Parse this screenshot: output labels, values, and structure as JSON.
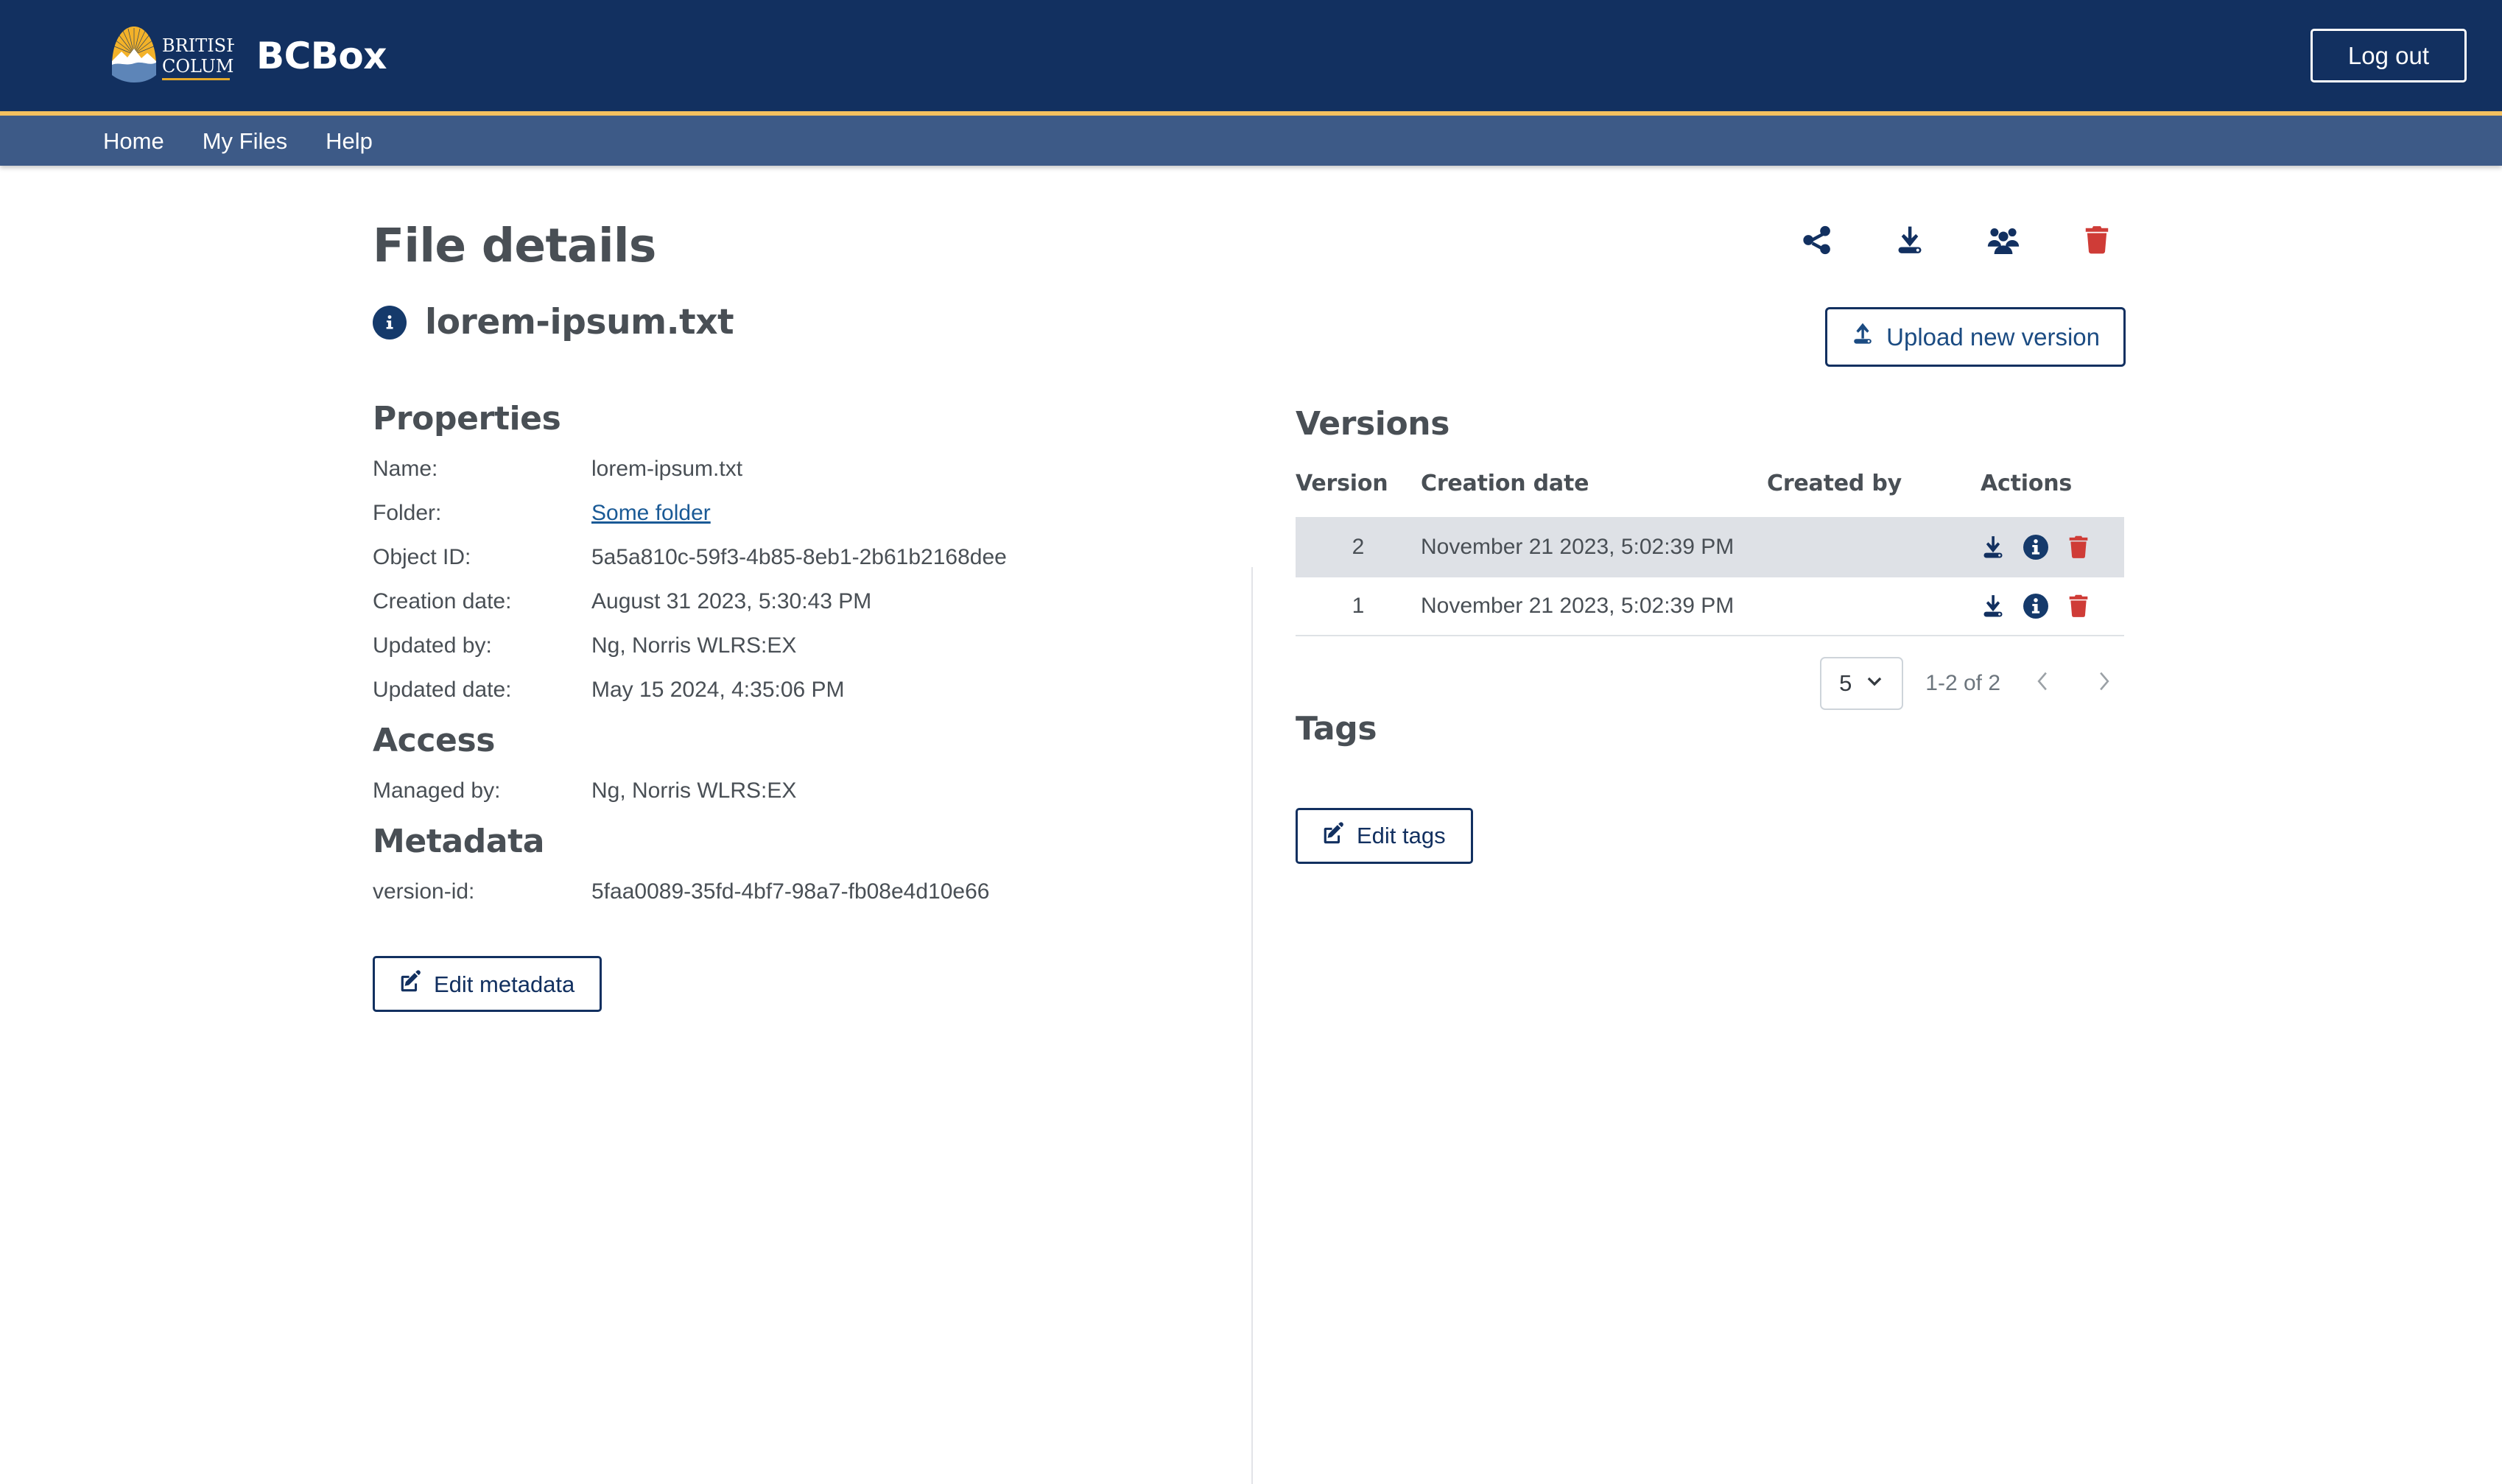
{
  "header": {
    "logo_name": "bc-government-logo",
    "logo_line1": "BRITISH",
    "logo_line2": "COLUMBIA",
    "app_title": "BCBox",
    "logout_label": "Log out",
    "brand_navy": "#123060",
    "brand_gold": "#f3c05f",
    "nav_blue": "#3d5a87"
  },
  "nav": {
    "items": [
      {
        "label": "Home"
      },
      {
        "label": "My Files"
      },
      {
        "label": "Help"
      }
    ]
  },
  "main": {
    "page_title": "File details",
    "file_name": "lorem-ipsum.txt",
    "file_icon": "info-circle-icon",
    "toolbar": [
      {
        "name": "share-icon",
        "title": "Share"
      },
      {
        "name": "download-icon",
        "title": "Download"
      },
      {
        "name": "permissions-people-icon",
        "title": "Permissions"
      },
      {
        "name": "delete-trash-icon",
        "title": "Delete",
        "color": "#cf3c37"
      }
    ]
  },
  "properties": {
    "heading": "Properties",
    "rows": [
      {
        "label": "Name:",
        "value": "lorem-ipsum.txt",
        "link": false
      },
      {
        "label": "Folder:",
        "value": "Some folder",
        "link": true
      },
      {
        "label": "Object ID:",
        "value": "5a5a810c-59f3-4b85-8eb1-2b61b2168dee",
        "link": false
      },
      {
        "label": "Creation date:",
        "value": "August 31 2023, 5:30:43 PM",
        "link": false
      },
      {
        "label": "Updated by:",
        "value": "Ng, Norris WLRS:EX",
        "link": false
      },
      {
        "label": "Updated date:",
        "value": "May 15 2024, 4:35:06 PM",
        "link": false
      }
    ]
  },
  "access": {
    "heading": "Access",
    "rows": [
      {
        "label": "Managed by:",
        "value": "Ng, Norris WLRS:EX"
      }
    ]
  },
  "metadata": {
    "heading": "Metadata",
    "rows": [
      {
        "label": "version-id:",
        "value": "5faa0089-35fd-4bf7-98a7-fb08e4d10e66"
      }
    ],
    "edit_button_label": "Edit metadata",
    "edit_button_icon": "pencil-square-icon"
  },
  "versions": {
    "upload_button_label": "Upload new version",
    "upload_button_icon": "upload-icon",
    "heading": "Versions",
    "columns": [
      "Version",
      "Creation date",
      "Created by",
      "Actions"
    ],
    "rows": [
      {
        "version": "2",
        "creation_date": "November 21 2023, 5:02:39 PM",
        "created_by": "",
        "selected": true
      },
      {
        "version": "1",
        "creation_date": "November 21 2023, 5:02:39 PM",
        "created_by": "",
        "selected": false
      }
    ],
    "row_actions": [
      "download-icon",
      "info-circle-icon",
      "delete-trash-icon"
    ],
    "paginator": {
      "rows_per_page": "5",
      "range_label": "1-2 of 2",
      "prev_icon": "chevron-left-icon",
      "next_icon": "chevron-right-icon"
    }
  },
  "tags": {
    "heading": "Tags",
    "edit_button_label": "Edit tags",
    "edit_button_icon": "pencil-square-icon"
  }
}
